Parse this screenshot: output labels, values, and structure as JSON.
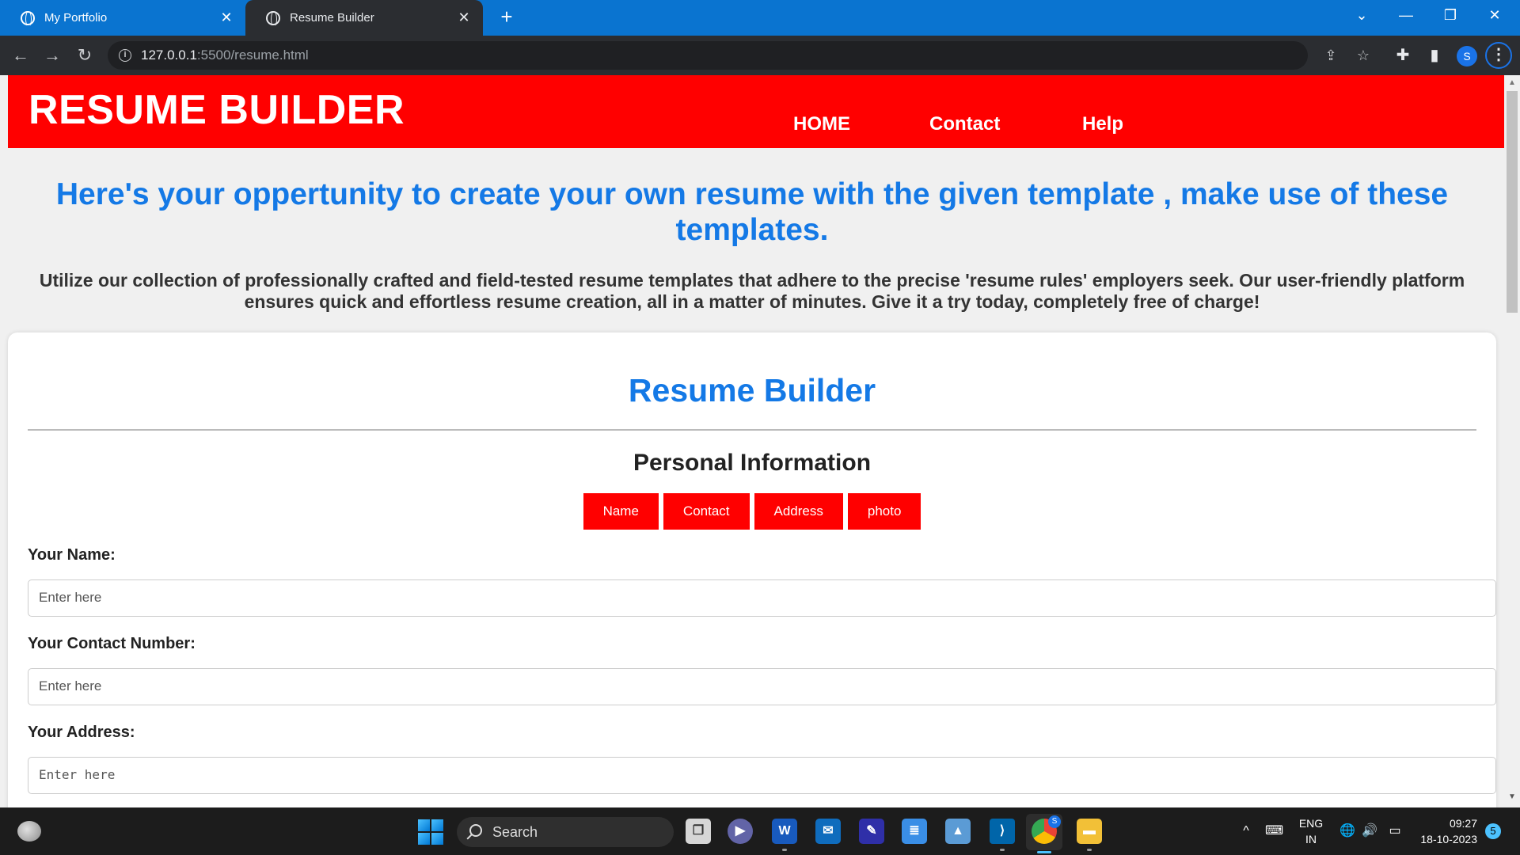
{
  "browser": {
    "tabs": [
      {
        "title": "My Portfolio",
        "close": "✕"
      },
      {
        "title": "Resume Builder",
        "close": "✕"
      }
    ],
    "new_tab": "+",
    "window_controls": {
      "list": "⌄",
      "minimize": "—",
      "restore": "❐",
      "close": "✕"
    },
    "url_host": "127.0.0.1",
    "url_rest": ":5500/resume.html",
    "profile_initial": "S"
  },
  "site": {
    "brand": "RESUME BUILDER",
    "nav": [
      "HOME",
      "Contact",
      "Help"
    ],
    "hero_heading": "Here's your oppertunity to create your own resume with the given template , make use of these templates.",
    "hero_text": "Utilize our collection of professionally crafted and field-tested resume templates that adhere to the precise 'resume rules' employers seek. Our user-friendly platform ensures quick and effortless resume creation, all in a matter of minutes. Give it a try today, completely free of charge!",
    "card_title": "Resume Builder",
    "section_title": "Personal Information",
    "section_tabs": [
      "Name",
      "Contact",
      "Address",
      "photo"
    ],
    "fields": [
      {
        "label": "Your Name:",
        "placeholder": "Enter here"
      },
      {
        "label": "Your Contact Number:",
        "placeholder": "Enter here"
      },
      {
        "label": "Your Address:",
        "placeholder": "Enter here"
      }
    ],
    "accent_color": "#ff0000",
    "heading_color": "#1479e6"
  },
  "taskbar": {
    "search_label": "Search",
    "language": "ENG",
    "region": "IN",
    "time": "09:27",
    "date": "18-10-2023",
    "notification_count": "5",
    "chrome_profile_badge": "S"
  }
}
